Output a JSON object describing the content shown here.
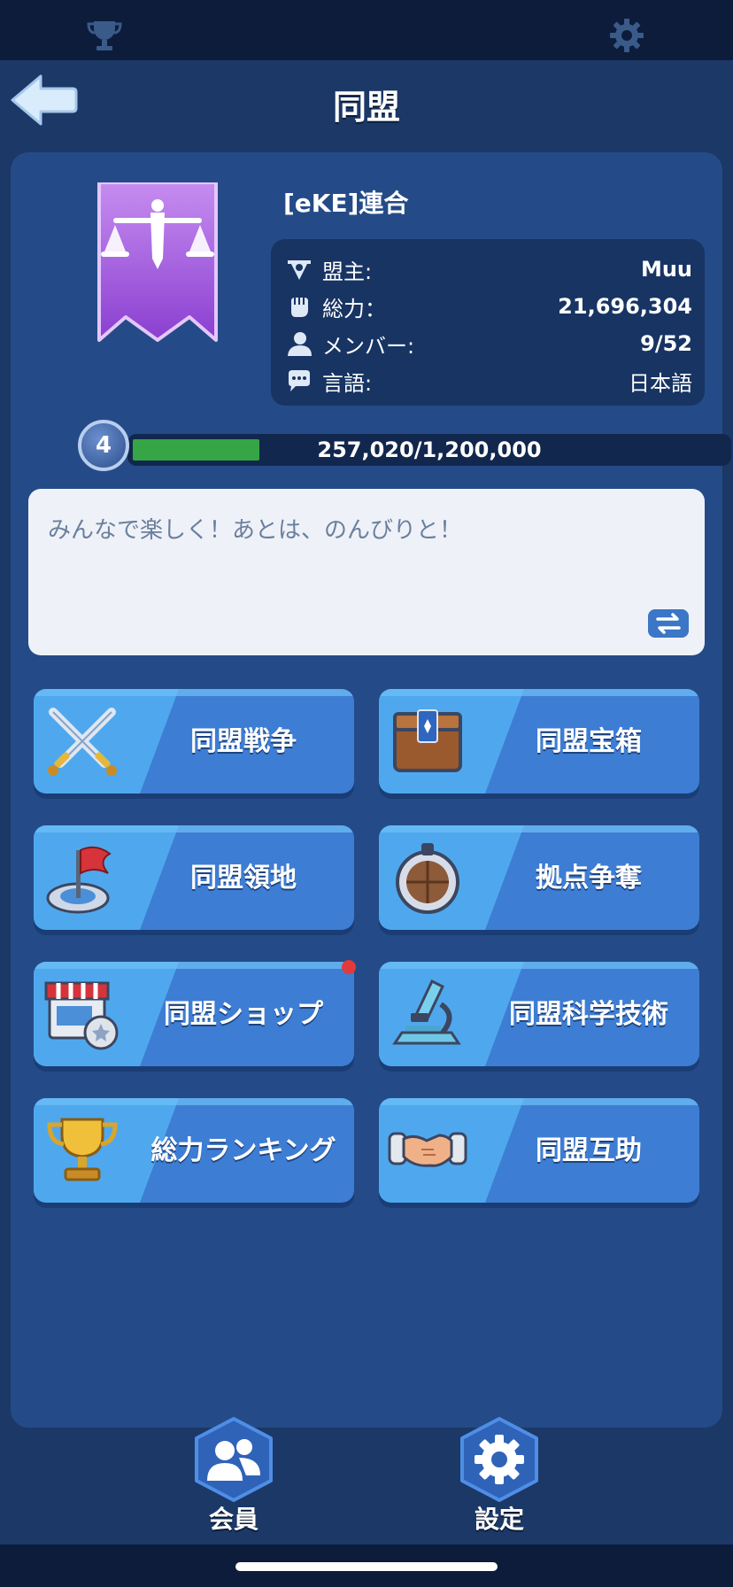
{
  "header": {
    "title": "同盟",
    "top_icons": [
      "trophy-icon",
      "gear-icon"
    ]
  },
  "alliance": {
    "name": "[eKE]連合",
    "info": [
      {
        "label": "盟主:",
        "value": "Muu",
        "icon": "leader-shield-icon"
      },
      {
        "label": "総力：",
        "value": "21,696,304",
        "icon": "fist-icon"
      },
      {
        "label": "メンバー:",
        "value": "9/52",
        "icon": "member-icon"
      },
      {
        "label": "言語:",
        "value": "日本語",
        "icon": "chat-bubble-icon"
      }
    ],
    "level": "4",
    "xp_text": "257,020/1,200,000",
    "xp_progress": 0.214,
    "motto": "みんなで楽しく！あとは、のんびりと！"
  },
  "menu": [
    {
      "label": "同盟戦争",
      "icon": "crossed-swords-icon"
    },
    {
      "label": "同盟宝箱",
      "icon": "treasure-chest-icon"
    },
    {
      "label": "同盟領地",
      "icon": "territory-flag-icon"
    },
    {
      "label": "拠点争奪",
      "icon": "stronghold-icon"
    },
    {
      "label": "同盟ショップ",
      "icon": "shop-icon",
      "notification": true
    },
    {
      "label": "同盟科学技術",
      "icon": "microscope-icon"
    },
    {
      "label": "総力ランキング",
      "icon": "trophy-cup-icon"
    },
    {
      "label": "同盟互助",
      "icon": "handshake-icon"
    }
  ],
  "bottom_tabs": [
    {
      "label": "会員",
      "icon": "members-icon"
    },
    {
      "label": "設定",
      "icon": "settings-gear-icon"
    }
  ],
  "colors": {
    "background": "#1b3867",
    "panel": "#244b87",
    "button": "#3d7dd4",
    "xp_fill": "#35a546",
    "notification": "#e23a3a"
  }
}
